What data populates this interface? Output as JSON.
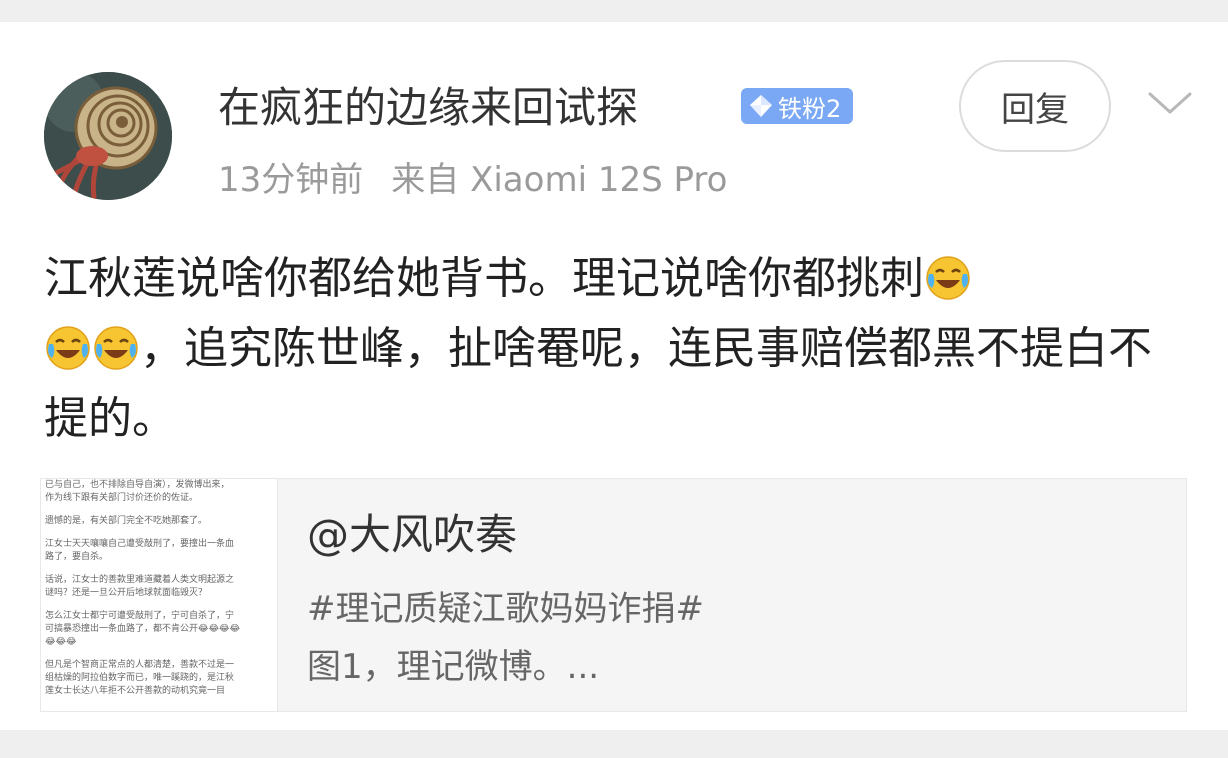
{
  "post": {
    "username": "在疯狂的边缘来回试探",
    "badge": "铁粉2",
    "time": "13分钟前",
    "source": "来自 Xiaomi 12S Pro",
    "reply_label": "回复",
    "text_parts": [
      "江秋莲说啥你都给她背书。理记说啥你都挑刺",
      "，追究陈世峰，扯啥罨呢，连民事赔偿都黑不提白不提的。"
    ]
  },
  "quote": {
    "author": "@大风吹奏",
    "line1": "#理记质疑江歌妈妈诈捐#",
    "line2": "图1，理记微博。...",
    "thumb_lines": [
      "已与自己，也不排除自导自演），发微博出来，",
      "作为线下跟有关部门讨价还价的佐证。",
      "",
      "遗憾的是，有关部门完全不吃她那套了。",
      "",
      "江女士天天嚷嚷自己遭受敲刑了，要撞出一条血",
      "路了，要自杀。",
      "",
      "话说，江女士的善款里难道藏着人类文明起源之",
      "谜吗？还是一旦公开后地球就面临毁灭？",
      "",
      "怎么江女士都宁可遭受敲刑了，宁可自杀了，宁",
      "可搞暴恐撞出一条血路了，都不肯公开😂😂😂😂",
      "😂😂😂",
      "",
      "但凡是个智商正常点的人都清楚，善款不过是一",
      "组枯燥的阿拉伯数字而已，唯一蹊跷的，是江秋",
      "莲女士长达八年拒不公开善款的动机究竟一目"
    ]
  },
  "colors": {
    "badge": "#7aa8f5",
    "meta": "#9a9a9a",
    "background": "#efefef"
  }
}
